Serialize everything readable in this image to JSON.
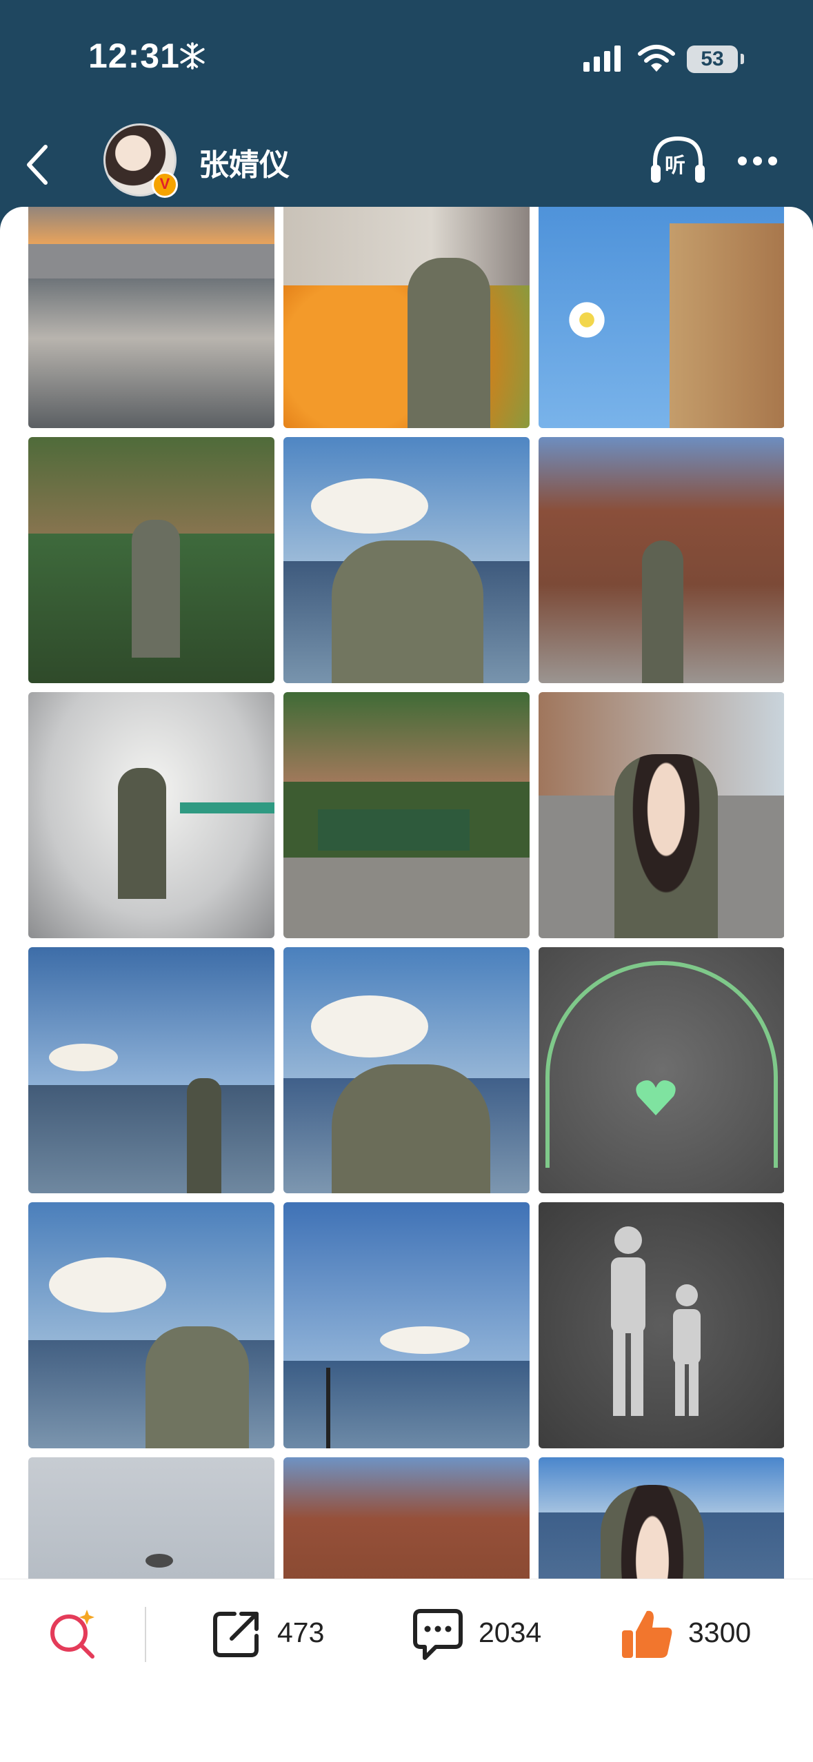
{
  "status_bar": {
    "time": "12:31",
    "battery": "53",
    "icons": [
      "snowflake-icon",
      "cellular-signal-icon",
      "wifi-icon",
      "battery-icon"
    ]
  },
  "header": {
    "back_icon": "chevron-left-icon",
    "user_name": "张婧仪",
    "listen_label": "听",
    "more_icon": "ellipsis-icon"
  },
  "gallery": {
    "photos": [
      {
        "subject": "city-skyline-sunset"
      },
      {
        "subject": "orange-stand-woman"
      },
      {
        "subject": "building-sky-daisies"
      },
      {
        "subject": "woman-on-bench-garden"
      },
      {
        "subject": "woman-arms-out-lake"
      },
      {
        "subject": "woman-brick-building-street"
      },
      {
        "subject": "woman-in-stairwell"
      },
      {
        "subject": "woman-on-park-bench"
      },
      {
        "subject": "selfie-street"
      },
      {
        "subject": "woman-on-pier-clouds"
      },
      {
        "subject": "woman-back-lake-clouds"
      },
      {
        "subject": "green-heart-sign"
      },
      {
        "subject": "woman-lake-clouds"
      },
      {
        "subject": "lake-clouds-lamppost"
      },
      {
        "subject": "pedestrian-sign-pavement"
      },
      {
        "subject": "seagull-sky"
      },
      {
        "subject": "brick-buildings"
      },
      {
        "subject": "woman-portrait-lake"
      }
    ]
  },
  "bottom_bar": {
    "share_count": "473",
    "comment_count": "2034",
    "like_count": "3300",
    "colors": {
      "like": "#f2762d",
      "search": "#e43b59",
      "text": "#222222"
    }
  }
}
